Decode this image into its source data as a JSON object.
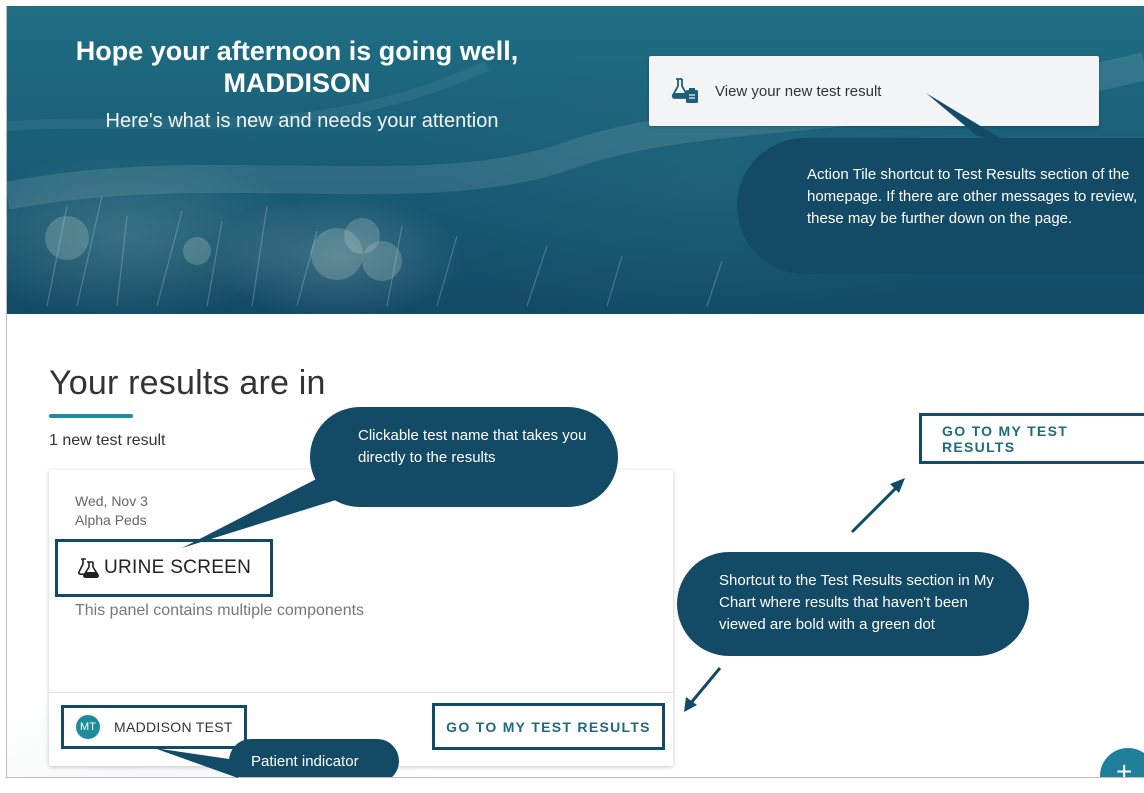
{
  "hero": {
    "greeting_line1": "Hope your afternoon is going well,",
    "greeting_line2": "MADDISON",
    "subtitle": "Here's what is new and needs your attention",
    "action_tile": {
      "icon": "test-results-icon",
      "label": "View your new test result"
    }
  },
  "results": {
    "title": "Your results are in",
    "count": "1 new test result",
    "go_button_label": "GO TO MY TEST RESULTS",
    "card": {
      "date": "Wed, Nov 3",
      "department": "Alpha Peds",
      "test_icon": "flask-icon",
      "test_name": "URINE SCREEN",
      "description": "This panel contains multiple components",
      "patient_initials": "MT",
      "patient_name": "MADDISON TEST",
      "button_label": "GO TO MY TEST RESULTS"
    }
  },
  "callouts": {
    "action_tile": "Action Tile shortcut to Test Results section of the homepage. If there are other messages to review, these may be further down on the page.",
    "test_name": "Clickable test name that takes you directly to the results",
    "shortcut": "Shortcut to the Test Results section in My Chart where results that haven't been viewed are bold with a green dot",
    "patient": "Patient indicator"
  },
  "fab": {
    "label": "+",
    "icon": "plus-icon"
  },
  "colors": {
    "hero_dark": "#134a66",
    "callout": "#134a66",
    "accent": "#1e8a9a",
    "button_text": "#1d6b80"
  }
}
